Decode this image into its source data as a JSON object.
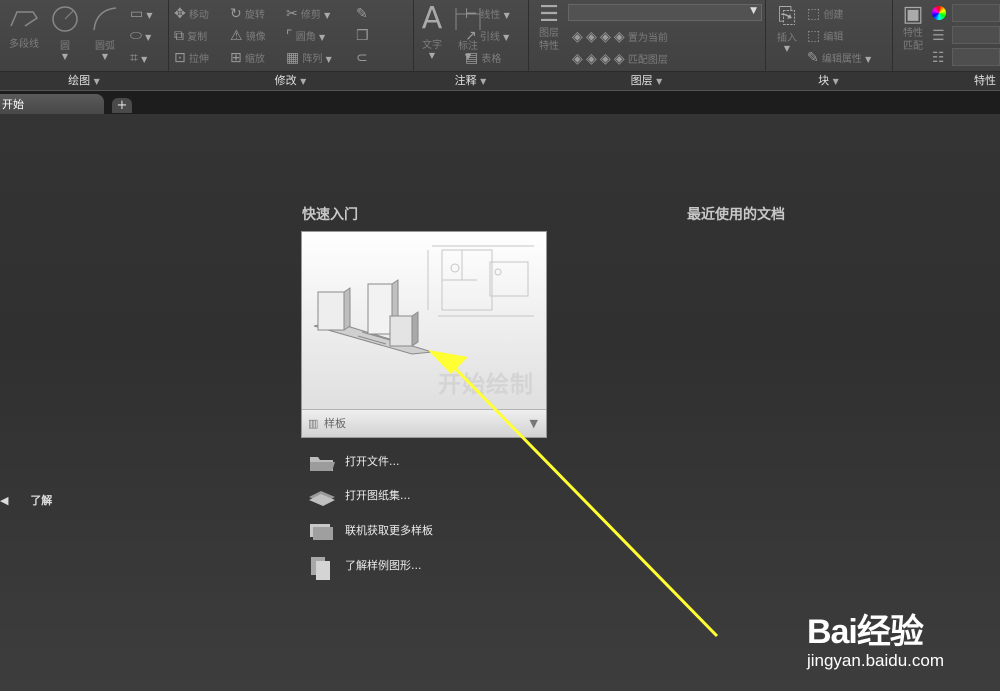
{
  "ribbon": {
    "draw": {
      "title": "绘图",
      "polyline": "多段线",
      "circle": "圆",
      "arc": "圆弧"
    },
    "modify": {
      "title": "修改",
      "move": "移动",
      "rotate": "旋转",
      "trim": "修剪",
      "copy": "复制",
      "mirror": "镜像",
      "fillet": "圆角",
      "stretch": "拉伸",
      "scale": "缩放",
      "array": "阵列"
    },
    "annotation": {
      "title": "注释",
      "text": "文字",
      "dimension": "标注",
      "linear": "线性",
      "leader": "引线",
      "table": "表格"
    },
    "layers": {
      "title": "图层",
      "layer_properties": "图层\n特性",
      "set_current": "置为当前",
      "match_layer": "匹配图层"
    },
    "block": {
      "title": "块",
      "insert": "插入",
      "create": "创建",
      "edit": "编辑",
      "edit_attributes": "编辑属性"
    },
    "properties": {
      "title": "特性",
      "match": "特性\n匹配"
    }
  },
  "tabs": {
    "start_tab": "开始",
    "add_tab": "+"
  },
  "start_page": {
    "quick_start_title": "快速入门",
    "recent_docs_title": "最近使用的文档",
    "start_drawing_label": "开始绘制",
    "template_label": "样板",
    "links": [
      {
        "label": "打开文件..."
      },
      {
        "label": "打开图纸集..."
      },
      {
        "label": "联机获取更多样板"
      },
      {
        "label": "了解样例图形..."
      }
    ],
    "learn_label": "了解"
  },
  "watermark": {
    "brand": "Bai经验",
    "url": "jingyan.baidu.com"
  },
  "colors": {
    "annotation_arrow": "#ffff33"
  }
}
